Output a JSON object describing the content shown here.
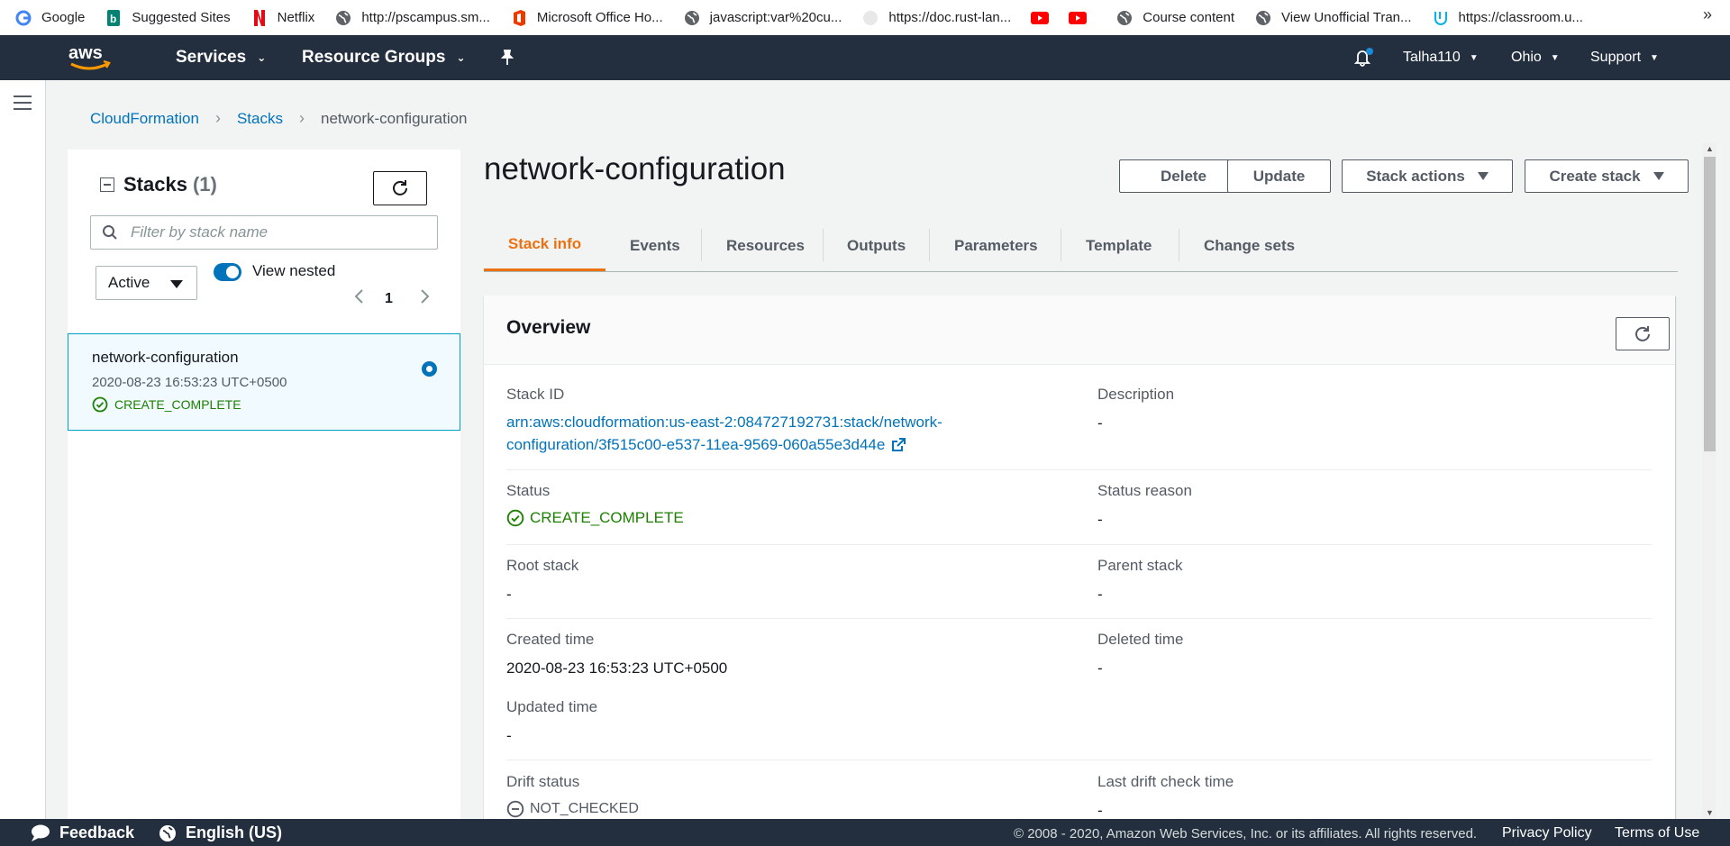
{
  "bookmarks": [
    {
      "label": "Google",
      "icon": "google-icon"
    },
    {
      "label": "Suggested Sites",
      "icon": "bing-icon"
    },
    {
      "label": "Netflix",
      "icon": "netflix-icon"
    },
    {
      "label": "http://pscampus.sm...",
      "icon": "globe-icon"
    },
    {
      "label": "Microsoft Office Ho...",
      "icon": "office-icon"
    },
    {
      "label": "javascript:var%20cu...",
      "icon": "globe-icon"
    },
    {
      "label": "https://doc.rust-lan...",
      "icon": "rust-icon"
    },
    {
      "label": "",
      "icon": "youtube-icon"
    },
    {
      "label": "",
      "icon": "youtube-icon"
    },
    {
      "label": "Course content",
      "icon": "globe-icon"
    },
    {
      "label": "View Unofficial Tran...",
      "icon": "globe-icon"
    },
    {
      "label": "https://classroom.u...",
      "icon": "udacity-icon"
    }
  ],
  "topnav": {
    "services": "Services",
    "resource_groups": "Resource Groups",
    "user": "Talha110",
    "region": "Ohio",
    "support": "Support"
  },
  "breadcrumb": [
    "CloudFormation",
    "Stacks",
    "network-configuration"
  ],
  "stacks_panel": {
    "title": "Stacks",
    "count": "(1)",
    "filter_placeholder": "Filter by stack name",
    "status_filter": "Active",
    "view_nested_label": "View nested",
    "view_nested_on": true,
    "page": "1",
    "items": [
      {
        "name": "network-configuration",
        "created": "2020-08-23 16:53:23 UTC+0500",
        "status": "CREATE_COMPLETE"
      }
    ]
  },
  "stack": {
    "title": "network-configuration",
    "actions": {
      "delete": "Delete",
      "update": "Update",
      "stack_actions": "Stack actions",
      "create_stack": "Create stack"
    },
    "tabs": [
      "Stack info",
      "Events",
      "Resources",
      "Outputs",
      "Parameters",
      "Template",
      "Change sets"
    ],
    "active_tab": "Stack info"
  },
  "overview": {
    "title": "Overview",
    "stack_id_label": "Stack ID",
    "stack_id_line1": "arn:aws:cloudformation:us-east-2:084727192731:stack/network-",
    "stack_id_line2": "configuration/3f515c00-e537-11ea-9569-060a55e3d44e",
    "description_label": "Description",
    "description_value": "-",
    "status_label": "Status",
    "status_value": "CREATE_COMPLETE",
    "status_reason_label": "Status reason",
    "status_reason_value": "-",
    "root_stack_label": "Root stack",
    "root_stack_value": "-",
    "parent_stack_label": "Parent stack",
    "parent_stack_value": "-",
    "created_time_label": "Created time",
    "created_time_value": "2020-08-23 16:53:23 UTC+0500",
    "deleted_time_label": "Deleted time",
    "deleted_time_value": "-",
    "updated_time_label": "Updated time",
    "updated_time_value": "-",
    "drift_status_label": "Drift status",
    "drift_status_value": "NOT_CHECKED",
    "last_drift_label": "Last drift check time",
    "last_drift_value": "-"
  },
  "footer": {
    "feedback": "Feedback",
    "language": "English (US)",
    "copyright": "© 2008 - 2020, Amazon Web Services, Inc. or its affiliates. All rights reserved.",
    "privacy": "Privacy Policy",
    "terms": "Terms of Use"
  },
  "colors": {
    "nav_bg": "#232f3e",
    "accent_orange": "#ec7211",
    "link_blue": "#0073bb",
    "success_green": "#1d8102"
  }
}
